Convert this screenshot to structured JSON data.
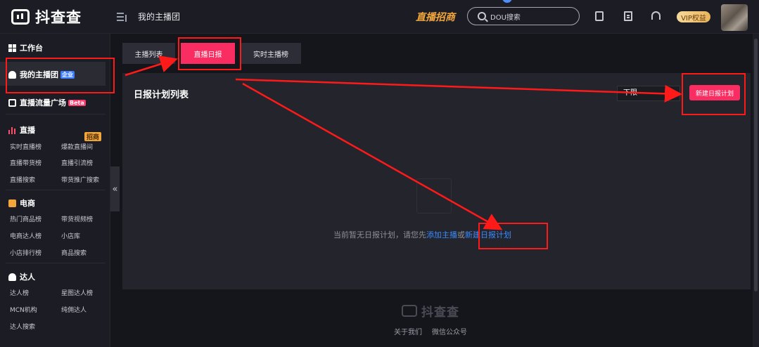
{
  "header": {
    "logo_text": "抖查查",
    "page_title": "我的主播团",
    "promo": "直播招商",
    "search_placeholder": "DOU搜索",
    "vip_label": "VIP权益"
  },
  "sidebar": {
    "workbench": "工作台",
    "my_team": "我的主播团",
    "my_team_badge": "企业",
    "traffic": "直播流量广场",
    "traffic_badge": "Beta",
    "live": {
      "title": "直播",
      "badge": "招商",
      "links": [
        "实时直播榜",
        "爆款直播间",
        "直播带货榜",
        "直播引流榜",
        "直播搜索",
        "带货推广搜索"
      ]
    },
    "ecommerce": {
      "title": "电商",
      "links": [
        "热门商品榜",
        "带货视频榜",
        "电商达人榜",
        "小店库",
        "小店排行榜",
        "商品搜索"
      ]
    },
    "talent": {
      "title": "达人",
      "links": [
        "达人榜",
        "星图达人榜",
        "MCN机构",
        "纯佣达人",
        "达人搜索"
      ]
    },
    "collapse_glyph": "«"
  },
  "tabs": [
    {
      "label": "主播列表",
      "active": false
    },
    {
      "label": "直播日报",
      "active": true
    },
    {
      "label": "实时主播榜",
      "active": false
    }
  ],
  "panel": {
    "title": "日报计划列表",
    "select_value": "下限",
    "new_button": "新建日报计划",
    "empty_prefix": "当前暂无日报计划，请您先",
    "empty_link1": "添加主播",
    "empty_mid": "或",
    "empty_link2": "新建日报计划"
  },
  "footer": {
    "logo_text": "抖查查",
    "links": [
      "关于我们",
      "微信公众号"
    ]
  },
  "colors": {
    "accent": "#fa2d63",
    "link": "#3b8bff",
    "annotation": "#ff1a1a"
  }
}
